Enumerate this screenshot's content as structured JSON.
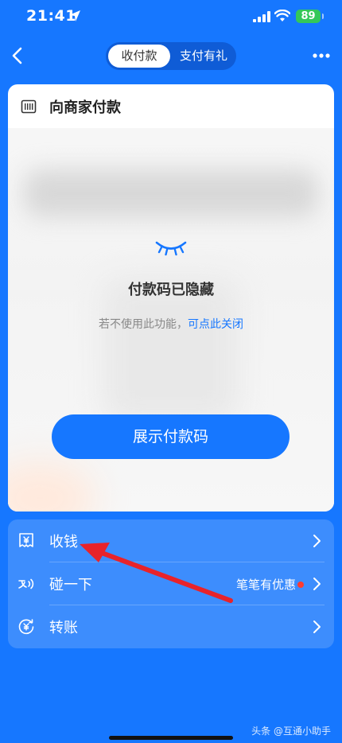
{
  "status_bar": {
    "time": "21:41",
    "battery": "89"
  },
  "nav": {
    "tab_active": "收付款",
    "tab_inactive": "支付有礼"
  },
  "card": {
    "title": "向商家付款",
    "hidden_title": "付款码已隐藏",
    "hint_text": "若不使用此功能，",
    "hint_link": "可点此关闭",
    "show_button": "展示付款码"
  },
  "actions": [
    {
      "label": "收钱",
      "icon": "yuan-receipt-icon"
    },
    {
      "label": "碰一下",
      "icon": "nfc-tap-icon",
      "promo": "笔笔有优惠"
    },
    {
      "label": "转账",
      "icon": "transfer-icon"
    }
  ],
  "watermark": "头条 @互通小助手",
  "colors": {
    "brand_blue": "#1677ff",
    "list_blue": "#3d8dfd",
    "battery_green": "#34c759",
    "promo_dot": "#ff3b30",
    "arrow_red": "#e8232a"
  }
}
